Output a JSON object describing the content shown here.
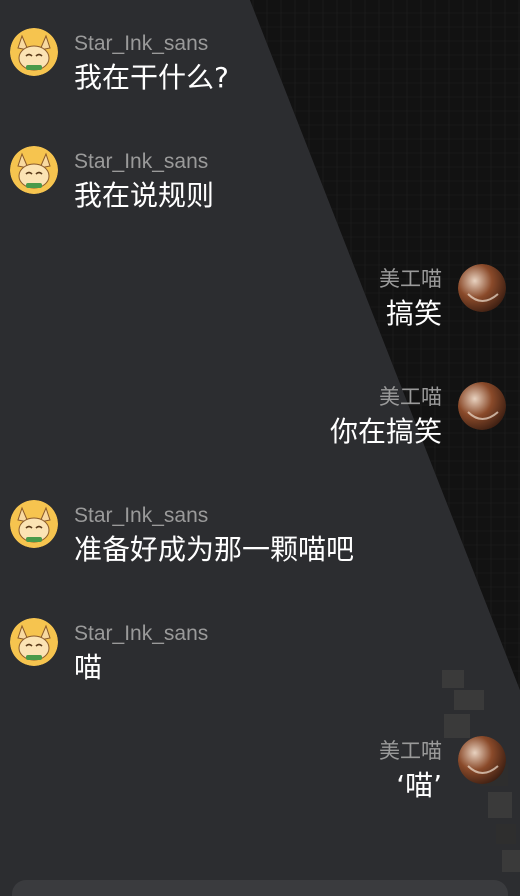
{
  "colors": {
    "username": "#9a9a9a",
    "message_text": "#ffffff",
    "panel_gray": "#2c2d30",
    "panel_dark": "#121212"
  },
  "messages": [
    {
      "side": "left",
      "avatar": "fox-avatar",
      "username": "Star_Ink_sans",
      "text": "我在干什么?"
    },
    {
      "side": "left",
      "avatar": "fox-avatar",
      "username": "Star_Ink_sans",
      "text": "我在说规则"
    },
    {
      "side": "right",
      "avatar": "sphere-avatar",
      "username": "美工喵",
      "text": "搞笑"
    },
    {
      "side": "right",
      "avatar": "sphere-avatar",
      "username": "美工喵",
      "text": "你在搞笑"
    },
    {
      "side": "left",
      "avatar": "fox-avatar",
      "username": "Star_Ink_sans",
      "text": "准备好成为那一颗喵吧"
    },
    {
      "side": "left",
      "avatar": "fox-avatar",
      "username": "Star_Ink_sans",
      "text": "喵"
    },
    {
      "side": "right",
      "avatar": "sphere-avatar",
      "username": "美工喵",
      "text": "‘喵’"
    }
  ]
}
